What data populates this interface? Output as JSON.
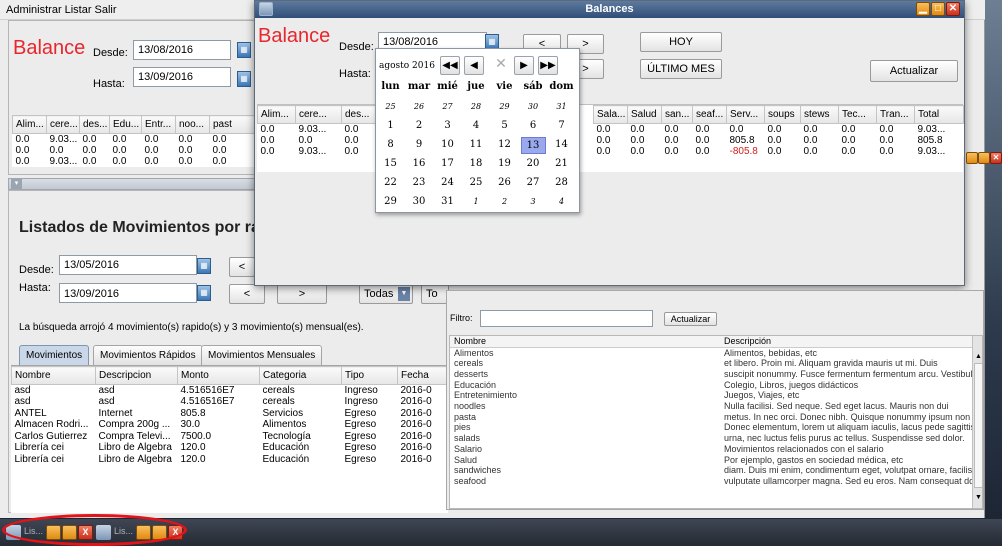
{
  "menubar": {
    "items": [
      "Administrar",
      "Listar",
      "Salir"
    ]
  },
  "balance_panel": {
    "title": "Balance",
    "desde_label": "Desde:",
    "desde_value": "13/08/2016",
    "hasta_label": "Hasta:",
    "hasta_value": "13/09/2016",
    "columns": [
      "Alim...",
      "cere...",
      "des...",
      "Edu...",
      "Entr...",
      "noo...",
      "past"
    ],
    "rows": [
      [
        "0.0",
        "9.03...",
        "0.0",
        "0.0",
        "0.0",
        "0.0",
        "0.0"
      ],
      [
        "0.0",
        "0.0",
        "0.0",
        "0.0",
        "0.0",
        "0.0",
        "0.0"
      ],
      [
        "0.0",
        "9.03...",
        "0.0",
        "0.0",
        "0.0",
        "0.0",
        "0.0"
      ]
    ]
  },
  "listados_panel": {
    "title": "Listados de Movimientos por rang",
    "desde_label": "Desde:",
    "desde_value": "13/05/2016",
    "hasta_label": "Hasta:",
    "hasta_value": "13/09/2016",
    "prev_label": "<",
    "next_label": ">",
    "combo_value": "Todas",
    "combo2_value": "To",
    "result_text": "La búsqueda arrojó 4 movimiento(s) rapido(s) y 3 movimiento(s) mensual(es).",
    "tabs": [
      "Movimientos",
      "Movimientos Rápidos",
      "Movimientos Mensuales"
    ],
    "columns": [
      "Nombre",
      "Descripcion",
      "Monto",
      "Categoria",
      "Tipo",
      "Fecha"
    ],
    "rows": [
      [
        "asd",
        "asd",
        "4.516516E7",
        "cereals",
        "Ingreso",
        "2016-0"
      ],
      [
        "asd",
        "asd",
        "4.516516E7",
        "cereals",
        "Ingreso",
        "2016-0"
      ],
      [
        "ANTEL",
        "Internet",
        "805.8",
        "Servicios",
        "Egreso",
        "2016-0"
      ],
      [
        "Almacen Rodri...",
        "Compra 200g ...",
        "30.0",
        "Alimentos",
        "Egreso",
        "2016-0"
      ],
      [
        "Carlos Gutierrez",
        "Compra Televi...",
        "7500.0",
        "Tecnología",
        "Egreso",
        "2016-0"
      ],
      [
        "Librería cei",
        "Libro de Álgebra",
        "120.0",
        "Educación",
        "Egreso",
        "2016-0"
      ],
      [
        "Librería cei",
        "Libro de Álgebra",
        "120.0",
        "Educación",
        "Egreso",
        "2016-0"
      ]
    ]
  },
  "balances_dialog": {
    "window_title": "Balances",
    "title": "Balance",
    "desde_label": "Desde:",
    "desde_value": "13/08/2016",
    "hasta_label": "Hasta:",
    "prev_label": "<",
    "next_label": ">",
    "hoy_label": "HOY",
    "ultimo_mes_label": "ÚLTIMO MES",
    "actualizar_label": "Actualizar",
    "columns_left": [
      "Alim...",
      "cere...",
      "des..."
    ],
    "columns_right": [
      "Sala...",
      "Salud",
      "san...",
      "seaf...",
      "Serv...",
      "soups",
      "stews",
      "Tec...",
      "Tran...",
      "Total"
    ],
    "rows_left": [
      [
        "0.0",
        "9.03...",
        "0.0"
      ],
      [
        "0.0",
        "0.0",
        "0.0"
      ],
      [
        "0.0",
        "9.03...",
        "0.0"
      ]
    ],
    "rows_right": [
      [
        "0.0",
        "0.0",
        "0.0",
        "0.0",
        "0.0",
        "0.0",
        "0.0",
        "0.0",
        "0.0",
        "9.03..."
      ],
      [
        "0.0",
        "0.0",
        "0.0",
        "0.0",
        "805.8",
        "0.0",
        "0.0",
        "0.0",
        "0.0",
        "805.8"
      ],
      [
        "0.0",
        "0.0",
        "0.0",
        "0.0",
        "-805.8",
        "0.0",
        "0.0",
        "0.0",
        "0.0",
        "9.03..."
      ]
    ]
  },
  "calendar": {
    "month_label": "agosto 2016",
    "weekdays": [
      "lun",
      "mar",
      "mié",
      "jue",
      "vie",
      "sáb",
      "dom"
    ],
    "weeks": [
      [
        "25",
        "26",
        "27",
        "28",
        "29",
        "30",
        "31"
      ],
      [
        "1",
        "2",
        "3",
        "4",
        "5",
        "6",
        "7"
      ],
      [
        "8",
        "9",
        "10",
        "11",
        "12",
        "13",
        "14"
      ],
      [
        "15",
        "16",
        "17",
        "18",
        "19",
        "20",
        "21"
      ],
      [
        "22",
        "23",
        "24",
        "25",
        "26",
        "27",
        "28"
      ],
      [
        "29",
        "30",
        "31",
        "1",
        "2",
        "3",
        "4"
      ]
    ],
    "selected_day": "13"
  },
  "list_panel": {
    "filtro_label": "Filtro:",
    "actualizar_label": "Actualizar",
    "columns": [
      "Nombre",
      "Descripción"
    ],
    "rows": [
      [
        "Alimentos",
        "Alimentos, bebidas, etc"
      ],
      [
        "cereals",
        "et libero. Proin mi. Aliquam gravida mauris ut mi. Duis"
      ],
      [
        "desserts",
        "suscipit nonummy. Fusce fermentum fermentum arcu. Vestibulum ..."
      ],
      [
        "Educación",
        "Colegio, Libros, juegos didácticos"
      ],
      [
        "Entretenimiento",
        "Juegos, Viajes, etc"
      ],
      [
        "noodles",
        "Nulla facilisi. Sed neque. Sed eget lacus. Mauris non dui"
      ],
      [
        "pasta",
        "metus. In nec orci. Donec nibh. Quisque nonummy ipsum non"
      ],
      [
        "pies",
        "Donec elementum, lorem ut aliquam iaculis, lacus pede sagittis a..."
      ],
      [
        "salads",
        "urna, nec luctus felis purus ac tellus. Suspendisse sed dolor."
      ],
      [
        "Salario",
        "Movimientos relacionados con el salario"
      ],
      [
        "Salud",
        "Por ejemplo, gastos en sociedad médica, etc"
      ],
      [
        "sandwiches",
        "diam. Duis mi enim, condimentum eget, volutpat ornare, facilisis e..."
      ],
      [
        "seafood",
        "vulputate ullamcorper magna. Sed eu eros. Nam consequat dolor ..."
      ]
    ]
  },
  "taskbar": {
    "items": [
      "Lis...",
      "Lis..."
    ]
  },
  "colors": {
    "red_accent": "#e8262d",
    "title_bar": "#2f4e78",
    "selection": "#9aa8ee"
  }
}
